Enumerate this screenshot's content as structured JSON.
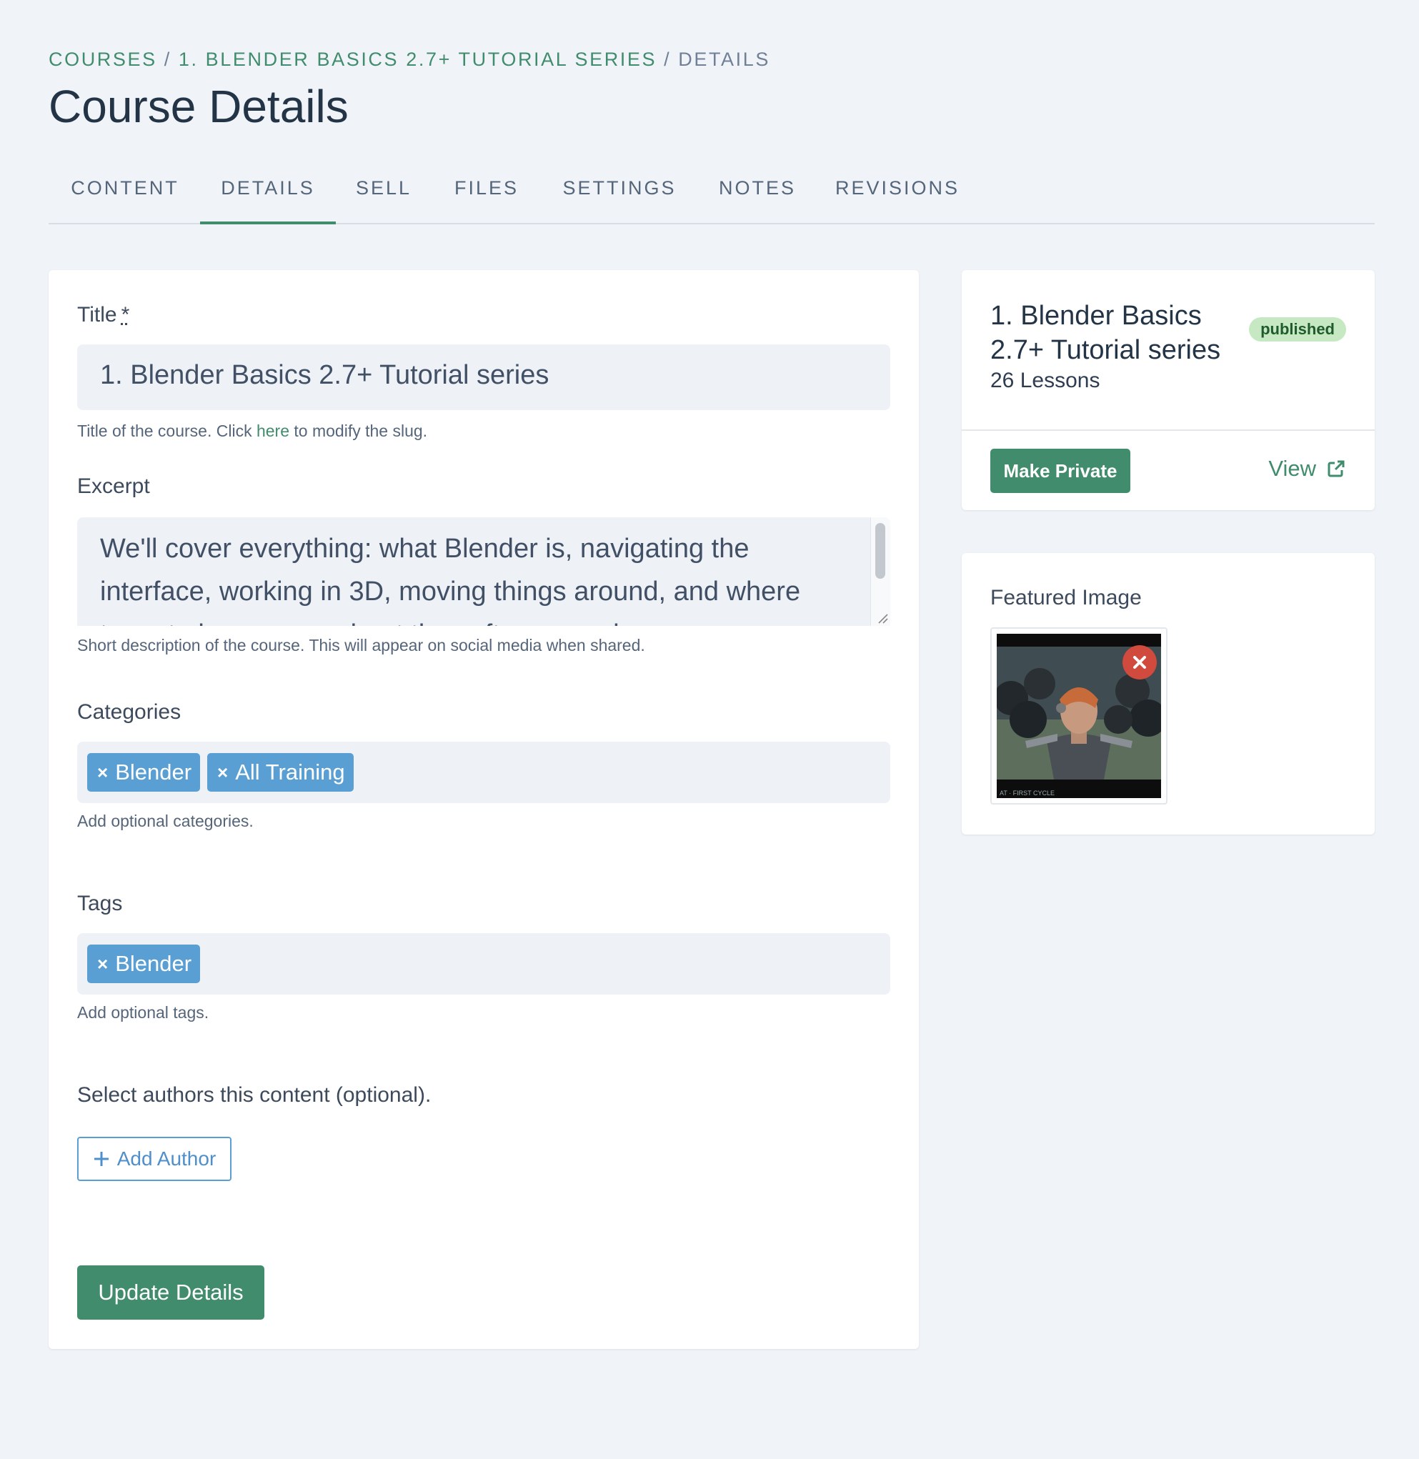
{
  "breadcrumb": {
    "items": [
      "COURSES",
      "1. BLENDER BASICS 2.7+ TUTORIAL SERIES"
    ],
    "separator": "/",
    "current": "DETAILS"
  },
  "page_title": "Course Details",
  "tabs": [
    {
      "label": "CONTENT",
      "active": false
    },
    {
      "label": "DETAILS",
      "active": true
    },
    {
      "label": "SELL",
      "active": false
    },
    {
      "label": "FILES",
      "active": false
    },
    {
      "label": "SETTINGS",
      "active": false
    },
    {
      "label": "NOTES",
      "active": false
    },
    {
      "label": "REVISIONS",
      "active": false
    }
  ],
  "form": {
    "title_label": "Title",
    "required_mark": "*",
    "title_value": "1. Blender Basics 2.7+ Tutorial series",
    "title_help_before": "Title of the course. Click ",
    "title_help_link": "here",
    "title_help_after": " to modify the slug.",
    "excerpt_label": "Excerpt",
    "excerpt_value": "We'll cover everything: what Blender is, navigating the interface, working in 3D, moving things around, and where to go to learn more about the software, and more.",
    "excerpt_help": "Short description of the course. This will appear on social media when shared.",
    "categories_label": "Categories",
    "categories": [
      "Blender",
      "All Training"
    ],
    "categories_help": "Add optional categories.",
    "tags_label": "Tags",
    "tags": [
      "Blender"
    ],
    "tags_help": "Add optional tags.",
    "remove_chip_glyph": "×",
    "authors_label": "Select authors this content (optional).",
    "add_author_label": "Add Author",
    "update_label": "Update Details"
  },
  "status_card": {
    "course_name": "1. Blender Basics 2.7+ Tutorial series",
    "status": "published",
    "lessons": "26 Lessons",
    "make_private_label": "Make Private",
    "view_label": "View"
  },
  "featured_image": {
    "label": "Featured Image",
    "caption": "AT · FIRST CYCLE"
  },
  "colors": {
    "accent": "#418c6c",
    "chip": "#5a9fd4",
    "badge_bg": "#c6e9c4",
    "remove": "#d04a3d",
    "background": "#f0f4f8"
  }
}
